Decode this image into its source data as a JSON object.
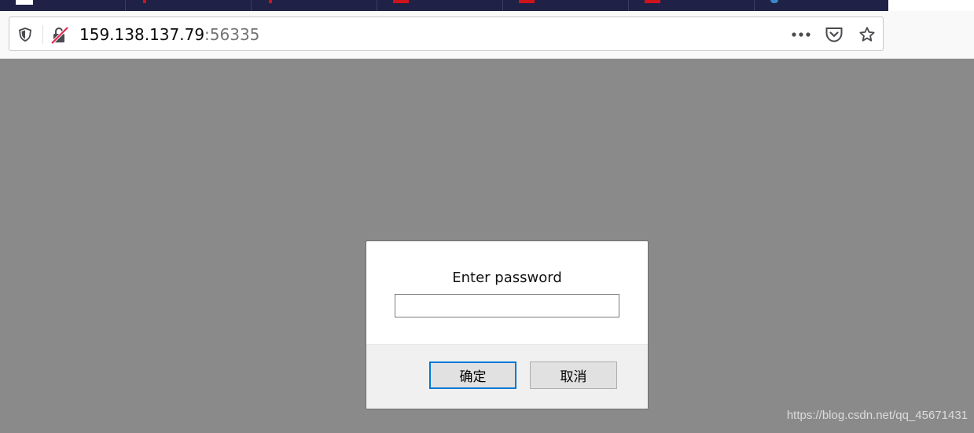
{
  "browser": {
    "tabs": [
      {
        "favicon": "page-icon",
        "color": "#ffffff"
      },
      {
        "favicon": "csdn-icon",
        "color": "#d0121b"
      },
      {
        "favicon": "csdn-icon",
        "color": "#d0121b"
      },
      {
        "favicon": "pdf-icon",
        "color": "#d0121b"
      },
      {
        "favicon": "pdf-icon",
        "color": "#d0121b"
      },
      {
        "favicon": "pdf-icon",
        "color": "#d0121b"
      },
      {
        "favicon": "globe-icon",
        "color": "#3a86c8"
      }
    ],
    "url": {
      "host": "159.138.137.79",
      "port": ":56335"
    },
    "toolbar_icons": [
      "shield-icon",
      "insecure-connection-icon",
      "more-icon",
      "pocket-icon",
      "bookmark-star-icon"
    ]
  },
  "dialog": {
    "message": "Enter password",
    "input_value": "",
    "ok_label": "确定",
    "cancel_label": "取消"
  },
  "watermark": "https://blog.csdn.net/qq_45671431",
  "colors": {
    "tabstrip": "#1f2246",
    "page_background": "#8a8a8a",
    "dialog_footer": "#f0f0f0",
    "focus_accent": "#0078d7"
  }
}
